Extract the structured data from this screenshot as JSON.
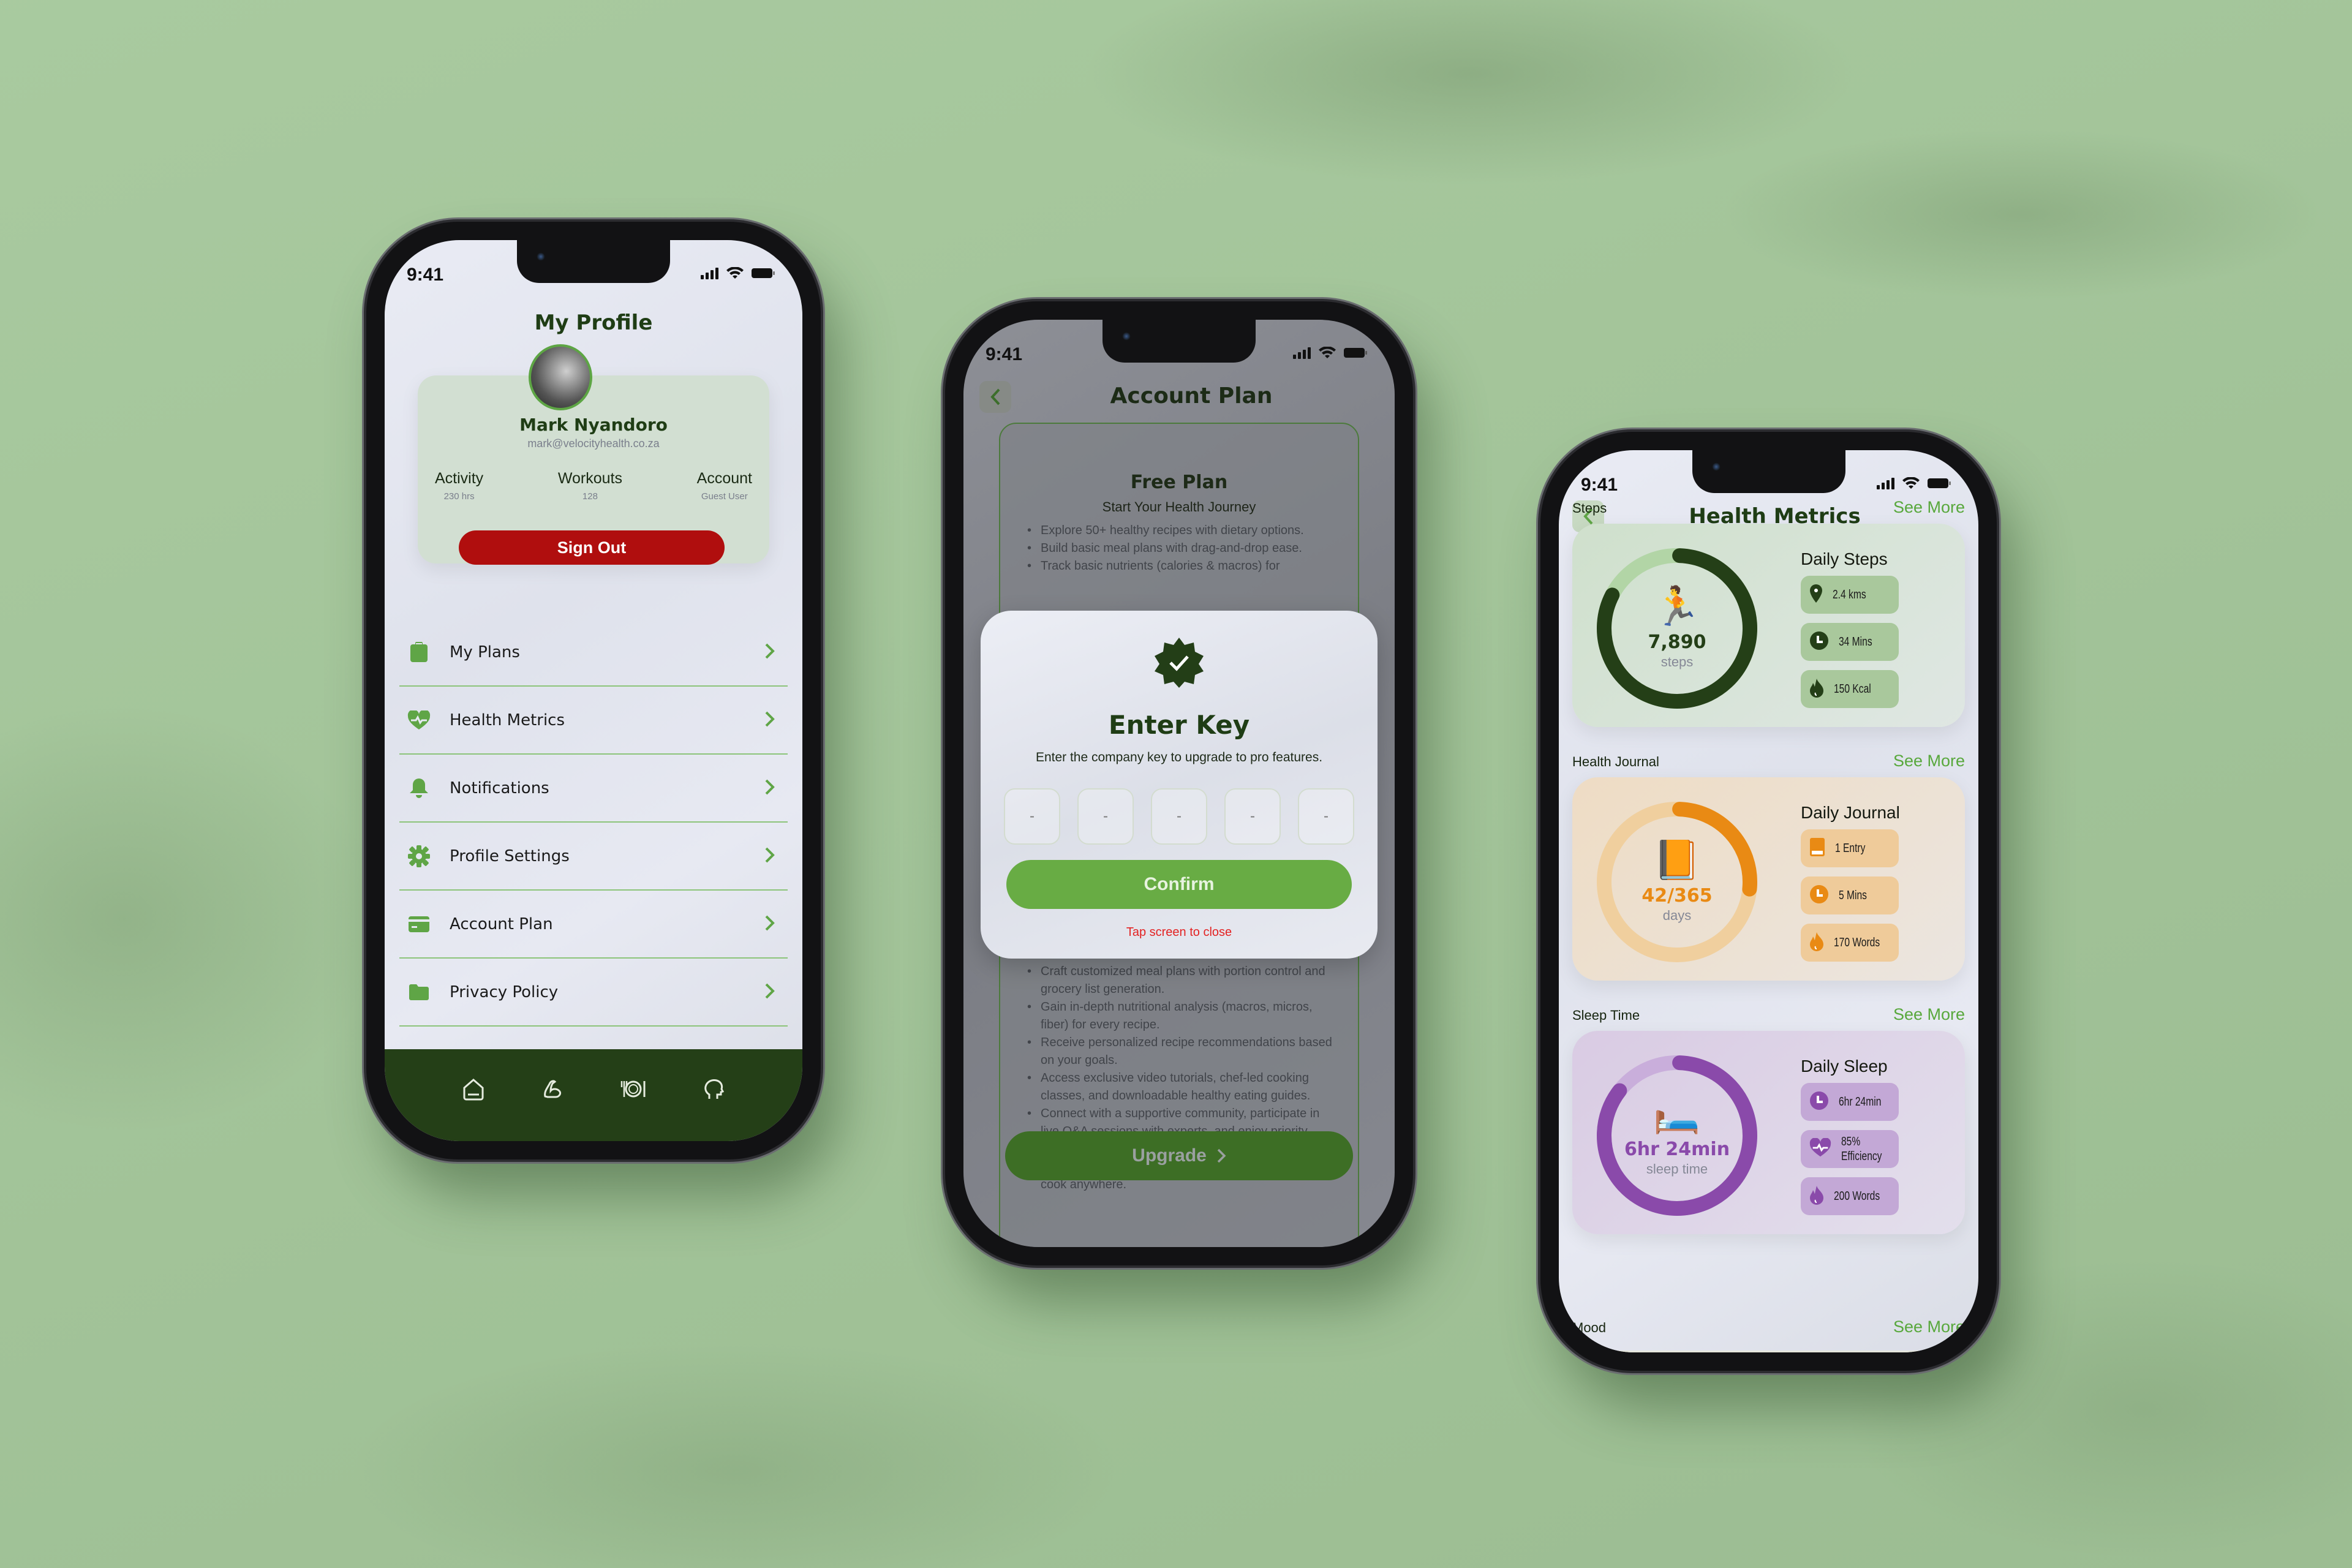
{
  "status_bar": {
    "time": "9:41",
    "icons": [
      "signal-icon",
      "wifi-icon",
      "battery-icon"
    ]
  },
  "profile_screen": {
    "title": "My Profile",
    "user": {
      "name": "Mark Nyandoro",
      "email": "mark@velocityhealth.co.za"
    },
    "stats": [
      {
        "label": "Activity",
        "value": "230 hrs"
      },
      {
        "label": "Workouts",
        "value": "128"
      },
      {
        "label": "Account",
        "value": "Guest User"
      }
    ],
    "sign_out_label": "Sign Out",
    "menu": [
      {
        "label": "My Plans",
        "icon": "clipboard-icon"
      },
      {
        "label": "Health Metrics",
        "icon": "heart-pulse-icon"
      },
      {
        "label": "Notifications",
        "icon": "bell-icon"
      },
      {
        "label": "Profile Settings",
        "icon": "gear-icon"
      },
      {
        "label": "Account Plan",
        "icon": "credit-card-icon"
      },
      {
        "label": "Privacy Policy",
        "icon": "folder-icon"
      }
    ],
    "bottom_nav": [
      "home-icon",
      "muscle-icon",
      "plate-icon",
      "head-icon"
    ]
  },
  "account_plan_screen": {
    "title": "Account Plan",
    "plan": {
      "name": "Free Plan",
      "subtitle": "Start Your Health Journey",
      "features_top": [
        "Explore 50+ healthy recipes with dietary options.",
        "Build basic meal plans with drag-and-drop ease.",
        "Track basic nutrients (calories & macros) for"
      ],
      "features_bottom": [
        "Craft customized meal plans with portion control and grocery list generation.",
        "Gain in-depth nutritional analysis (macros, micros, fiber) for every recipe.",
        "Receive personalized recipe recommendations based on your goals.",
        "Access exclusive video tutorials, chef-led cooking classes, and downloadable healthy eating guides.",
        "Connect with a supportive community, participate in live Q&A sessions with experts, and enjoy priority customer support.",
        "Download recipes and meal plans for offline access, cook anywhere."
      ],
      "upgrade_label": "Upgrade"
    },
    "modal": {
      "title": "Enter Key",
      "description": "Enter the company key to upgrade to pro features.",
      "key_placeholders": [
        "-",
        "-",
        "-",
        "-",
        "-"
      ],
      "confirm_label": "Confirm",
      "close_hint": "Tap screen to close"
    }
  },
  "health_metrics_screen": {
    "title": "Health Metrics",
    "see_more_label": "See More",
    "sections": [
      {
        "label": "Steps",
        "card_title": "Daily Steps",
        "value": "7,890",
        "unit": "steps",
        "emoji": "🏃",
        "progress": 0.82,
        "colors": {
          "track": "#b2d5a6",
          "arc": "#243f17",
          "value": "#243f17",
          "card": "#cfe0cc",
          "chip": "#a9c89c",
          "icon": "#243f17"
        },
        "chips": [
          {
            "icon": "location-pin-icon",
            "text": "2.4 kms"
          },
          {
            "icon": "clock-icon",
            "text": "34 Mins"
          },
          {
            "icon": "flame-icon",
            "text": "150 Kcal"
          }
        ]
      },
      {
        "label": "Health Journal",
        "card_title": "Daily Journal",
        "value": "42/365",
        "unit": "days",
        "emoji": "📙",
        "progress": 0.26,
        "colors": {
          "track": "#f0cf9e",
          "arc": "#e98a14",
          "value": "#e98a14",
          "card": "#eedcc4",
          "chip": "#efcb9a",
          "icon": "#e98a14"
        },
        "chips": [
          {
            "icon": "book-icon",
            "text": "1 Entry"
          },
          {
            "icon": "clock-icon",
            "text": "5 Mins"
          },
          {
            "icon": "flame-icon",
            "text": "170 Words"
          }
        ]
      },
      {
        "label": "Sleep Time",
        "card_title": "Daily Sleep",
        "value": "6hr 24min",
        "unit": "sleep time",
        "emoji": "🛏️",
        "progress": 0.85,
        "colors": {
          "track": "#c9aedb",
          "arc": "#8a4aaa",
          "value": "#8a4aaa",
          "card": "#d9cbe3",
          "chip": "#c3a8d6",
          "icon": "#8a4aaa"
        },
        "chips": [
          {
            "icon": "clock-icon",
            "text": "6hr 24min"
          },
          {
            "icon": "heart-pulse-icon",
            "text": "85%\nEfficiency"
          },
          {
            "icon": "flame-icon",
            "text": "200 Words"
          }
        ]
      },
      {
        "label": "Mood"
      }
    ]
  }
}
